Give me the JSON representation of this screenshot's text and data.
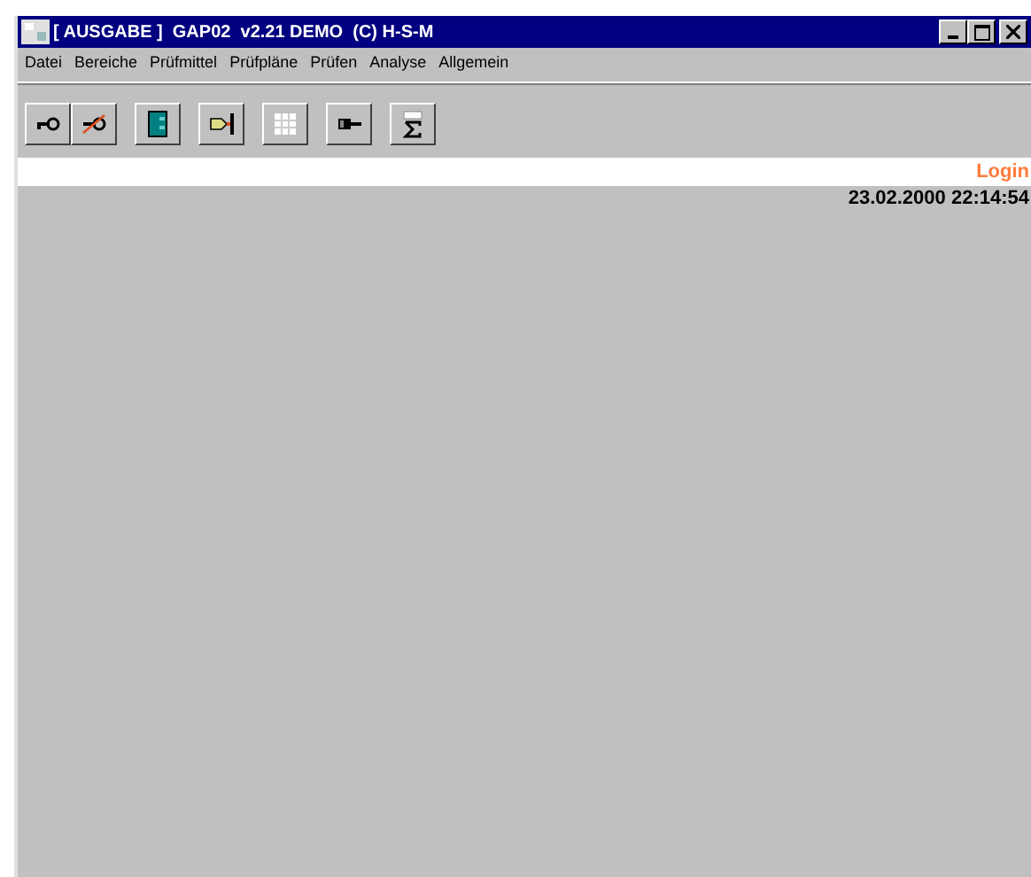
{
  "window": {
    "title": "[ AUSGABE ]  GAP02  v2.21 DEMO  (C) H-S-M"
  },
  "menu": [
    "Datei",
    "Bereiche",
    "Prüfmittel",
    "Prüfpläne",
    "Prüfen",
    "Analyse",
    "Allgemein"
  ],
  "toolbar_groups": [
    {
      "buttons": [
        {
          "kind": "key"
        },
        {
          "kind": "key-crossed"
        }
      ]
    },
    {
      "buttons": [
        {
          "kind": "door"
        }
      ]
    },
    {
      "buttons": [
        {
          "kind": "arrow-box"
        }
      ]
    },
    {
      "buttons": [
        {
          "kind": "grid"
        }
      ]
    },
    {
      "buttons": [
        {
          "kind": "plug"
        }
      ]
    },
    {
      "buttons": [
        {
          "kind": "sigma"
        }
      ]
    }
  ],
  "login": "Login",
  "datetime": "23.02.2000 22:14:54"
}
